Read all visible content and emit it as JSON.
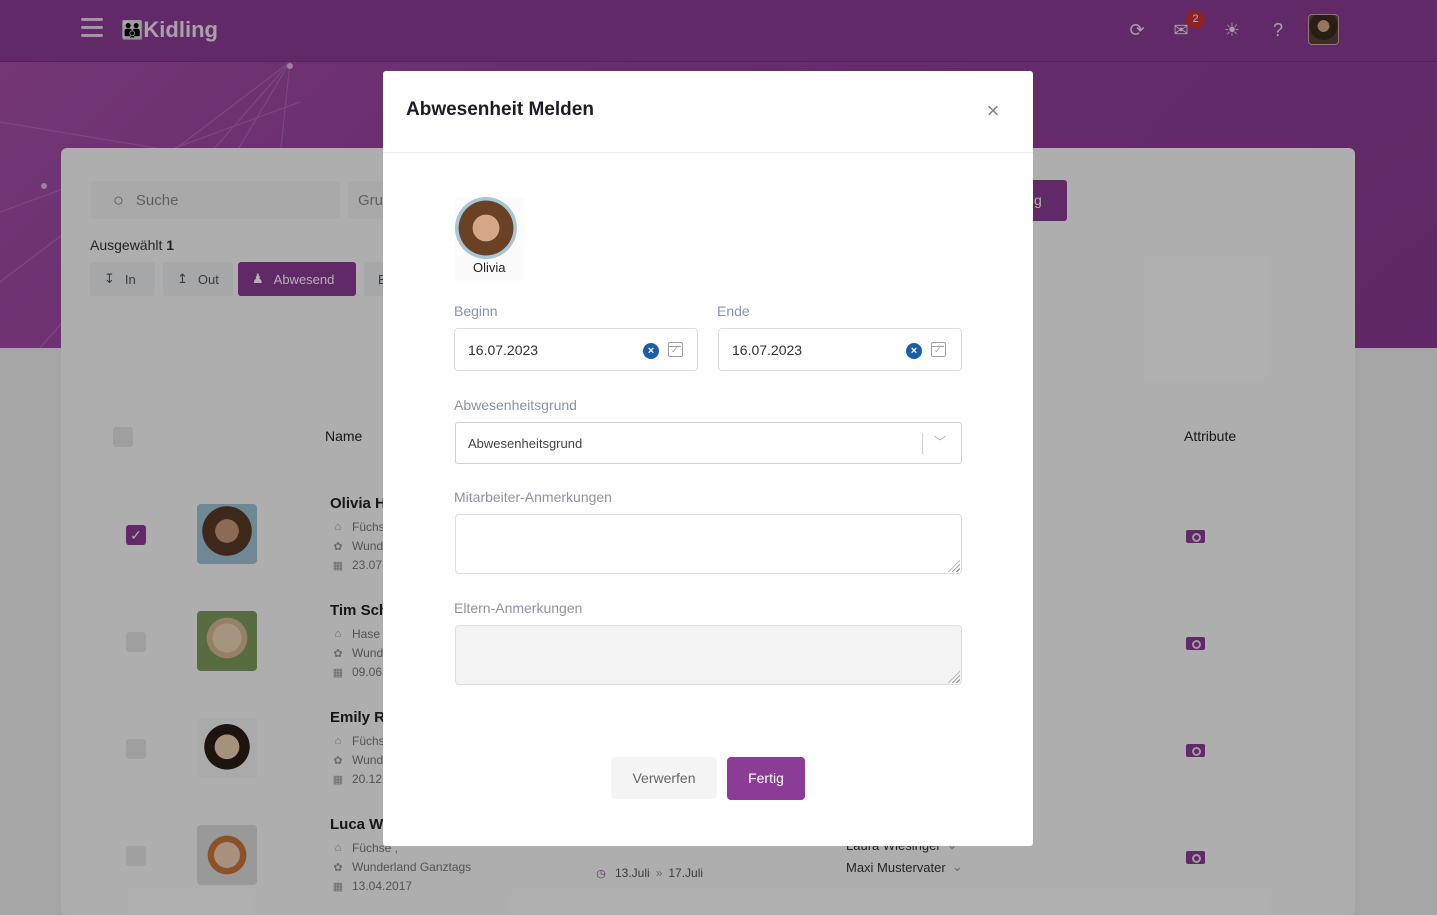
{
  "app": {
    "title": "Kidling"
  },
  "header": {
    "notification_count": "2"
  },
  "toolbar": {
    "search_placeholder": "Suche",
    "group_placeholder": "Grup",
    "done_label": "tig",
    "selected_label": "Ausgewählt",
    "selected_count": "1",
    "chips": [
      "In",
      "Out",
      "Abwesend",
      "E"
    ]
  },
  "table": {
    "columns": [
      "Name",
      "Attribute"
    ],
    "rows": [
      {
        "name": "Olivia H",
        "group": "Füchs",
        "location": "Wund",
        "birthday": "23.07.",
        "checked": true
      },
      {
        "name": "Tim Sch",
        "group": "Hase",
        "location": "Wund",
        "birthday": "09.06.",
        "checked": false
      },
      {
        "name": "Emily R",
        "group": "Füchs",
        "location": "Wund",
        "birthday": "20.12.",
        "checked": false
      },
      {
        "name": "Luca W",
        "group": "Füchse ,",
        "location": "Wunderland Ganztags",
        "birthday": "13.04.2017",
        "checked": false,
        "absence_from": "13.Juli",
        "absence_to": "17.Juli",
        "contacts": [
          "Laura Wiesinger",
          "Maxi Mustervater"
        ]
      }
    ]
  },
  "modal": {
    "title": "Abwesenheit Melden",
    "child_name": "Olivia",
    "start_label": "Beginn",
    "start_value": "16.07.2023",
    "end_label": "Ende",
    "end_value": "16.07.2023",
    "reason_label": "Abwesenheitsgrund",
    "reason_placeholder": "Abwesenheitsgrund",
    "staff_notes_label": "Mitarbeiter-Anmerkungen",
    "parent_notes_label": "Eltern-Anmerkungen",
    "discard_label": "Verwerfen",
    "done_label": "Fertig"
  }
}
